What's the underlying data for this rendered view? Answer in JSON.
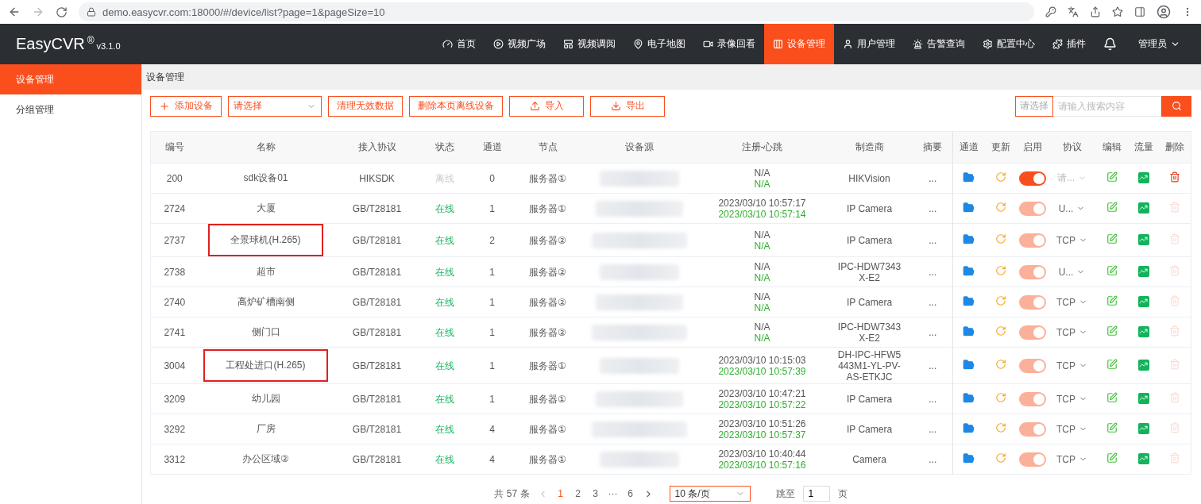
{
  "browser": {
    "address": "demo.easycvr.com:18000/#/device/list?page=1&pageSize=10"
  },
  "header": {
    "logo": "EasyCVR",
    "logo_mark": "®",
    "version": "v3.1.0",
    "user": "管理员",
    "nav": [
      {
        "label": "首页",
        "selected": false
      },
      {
        "label": "视频广场",
        "selected": false
      },
      {
        "label": "视频调阅",
        "selected": false
      },
      {
        "label": "电子地图",
        "selected": false
      },
      {
        "label": "录像回看",
        "selected": false
      },
      {
        "label": "设备管理",
        "selected": true
      },
      {
        "label": "用户管理",
        "selected": false
      },
      {
        "label": "告警查询",
        "selected": false
      },
      {
        "label": "配置中心",
        "selected": false
      },
      {
        "label": "插件",
        "selected": false
      }
    ]
  },
  "sidebar": {
    "items": [
      {
        "label": "设备管理",
        "selected": true
      },
      {
        "label": "分组管理",
        "selected": false
      }
    ]
  },
  "breadcrumb": "设备管理",
  "toolbar": {
    "add": "添加设备",
    "select_placeholder": "请选择",
    "clean": "清理无效数据",
    "delete_offline": "删除本页离线设备",
    "import": "导入",
    "export": "导出",
    "search_type": "请选择",
    "search_placeholder": "请输入搜索内容"
  },
  "table": {
    "columns": [
      "编号",
      "名称",
      "接入协议",
      "状态",
      "通道",
      "节点",
      "设备源",
      "注册-心跳",
      "制造商",
      "摘要"
    ],
    "action_columns": [
      "通道",
      "更新",
      "启用",
      "协议",
      "编辑",
      "流量",
      "删除"
    ],
    "rows": [
      {
        "id": "200",
        "name": "sdk设备01",
        "highlighted": false,
        "protocol": "HIKSDK",
        "status": "离线",
        "online": false,
        "channels": "0",
        "node": "服务器①",
        "register": "N/A",
        "heartbeat": "N/A",
        "manufacturer": [
          "HIKVision"
        ],
        "summary": "...",
        "enabled": true,
        "toggle_disabled": false,
        "transport": "请...",
        "transport_placeholder": true,
        "deletable": true
      },
      {
        "id": "2724",
        "name": "大厦",
        "highlighted": false,
        "protocol": "GB/T28181",
        "status": "在线",
        "online": true,
        "channels": "1",
        "node": "服务器①",
        "register": "2023/03/10 10:57:17",
        "heartbeat": "2023/03/10 10:57:14",
        "manufacturer": [
          "IP Camera"
        ],
        "summary": "...",
        "enabled": true,
        "toggle_disabled": true,
        "transport": "U...",
        "transport_placeholder": false,
        "deletable": false
      },
      {
        "id": "2737",
        "name": "全景球机(H.265)",
        "highlighted": true,
        "protocol": "GB/T28181",
        "status": "在线",
        "online": true,
        "channels": "2",
        "node": "服务器②",
        "register": "N/A",
        "heartbeat": "N/A",
        "manufacturer": [
          "IP Camera"
        ],
        "summary": "...",
        "enabled": true,
        "toggle_disabled": true,
        "transport": "TCP",
        "transport_placeholder": false,
        "deletable": false
      },
      {
        "id": "2738",
        "name": "超市",
        "highlighted": false,
        "protocol": "GB/T28181",
        "status": "在线",
        "online": true,
        "channels": "1",
        "node": "服务器②",
        "register": "N/A",
        "heartbeat": "N/A",
        "manufacturer": [
          "IPC-HDW7343",
          "X-E2"
        ],
        "summary": "...",
        "enabled": true,
        "toggle_disabled": true,
        "transport": "U...",
        "transport_placeholder": false,
        "deletable": false
      },
      {
        "id": "2740",
        "name": "高炉矿槽南侧",
        "highlighted": false,
        "protocol": "GB/T28181",
        "status": "在线",
        "online": true,
        "channels": "1",
        "node": "服务器②",
        "register": "N/A",
        "heartbeat": "N/A",
        "manufacturer": [
          "IP Camera"
        ],
        "summary": "...",
        "enabled": true,
        "toggle_disabled": true,
        "transport": "TCP",
        "transport_placeholder": false,
        "deletable": false
      },
      {
        "id": "2741",
        "name": "侧门口",
        "highlighted": false,
        "protocol": "GB/T28181",
        "status": "在线",
        "online": true,
        "channels": "1",
        "node": "服务器②",
        "register": "N/A",
        "heartbeat": "N/A",
        "manufacturer": [
          "IPC-HDW7343",
          "X-E2"
        ],
        "summary": "...",
        "enabled": true,
        "toggle_disabled": true,
        "transport": "TCP",
        "transport_placeholder": false,
        "deletable": false
      },
      {
        "id": "3004",
        "name": "工程处进口(H.265)",
        "highlighted": true,
        "protocol": "GB/T28181",
        "status": "在线",
        "online": true,
        "channels": "1",
        "node": "服务器①",
        "register": "2023/03/10 10:15:03",
        "heartbeat": "2023/03/10 10:57:39",
        "manufacturer": [
          "DH-IPC-HFW5",
          "443M1-YL-PV-",
          "AS-ETKJC"
        ],
        "summary": "...",
        "enabled": true,
        "toggle_disabled": true,
        "transport": "TCP",
        "transport_placeholder": false,
        "deletable": false
      },
      {
        "id": "3209",
        "name": "幼儿园",
        "highlighted": false,
        "protocol": "GB/T28181",
        "status": "在线",
        "online": true,
        "channels": "1",
        "node": "服务器①",
        "register": "2023/03/10 10:47:21",
        "heartbeat": "2023/03/10 10:57:22",
        "manufacturer": [
          "IP Camera"
        ],
        "summary": "...",
        "enabled": true,
        "toggle_disabled": true,
        "transport": "TCP",
        "transport_placeholder": false,
        "deletable": false
      },
      {
        "id": "3292",
        "name": "厂房",
        "highlighted": false,
        "protocol": "GB/T28181",
        "status": "在线",
        "online": true,
        "channels": "4",
        "node": "服务器①",
        "register": "2023/03/10 10:51:26",
        "heartbeat": "2023/03/10 10:57:37",
        "manufacturer": [
          "IP Camera"
        ],
        "summary": "...",
        "enabled": true,
        "toggle_disabled": true,
        "transport": "TCP",
        "transport_placeholder": false,
        "deletable": false
      },
      {
        "id": "3312",
        "name": "办公区域②",
        "highlighted": false,
        "protocol": "GB/T28181",
        "status": "在线",
        "online": true,
        "channels": "4",
        "node": "服务器①",
        "register": "2023/03/10 10:40:44",
        "heartbeat": "2023/03/10 10:57:16",
        "manufacturer": [
          "Camera"
        ],
        "summary": "...",
        "enabled": true,
        "toggle_disabled": true,
        "transport": "TCP",
        "transport_placeholder": false,
        "deletable": false
      }
    ]
  },
  "pagination": {
    "total": "共 57 条",
    "pages": [
      {
        "label": "1",
        "selected": true
      },
      {
        "label": "2",
        "selected": false
      },
      {
        "label": "3",
        "selected": false
      },
      {
        "label": "···",
        "selected": false
      },
      {
        "label": "6",
        "selected": false
      }
    ],
    "page_size": "10 条/页",
    "jump_label": "跳至",
    "jump_value": "1",
    "jump_suffix": "页"
  }
}
